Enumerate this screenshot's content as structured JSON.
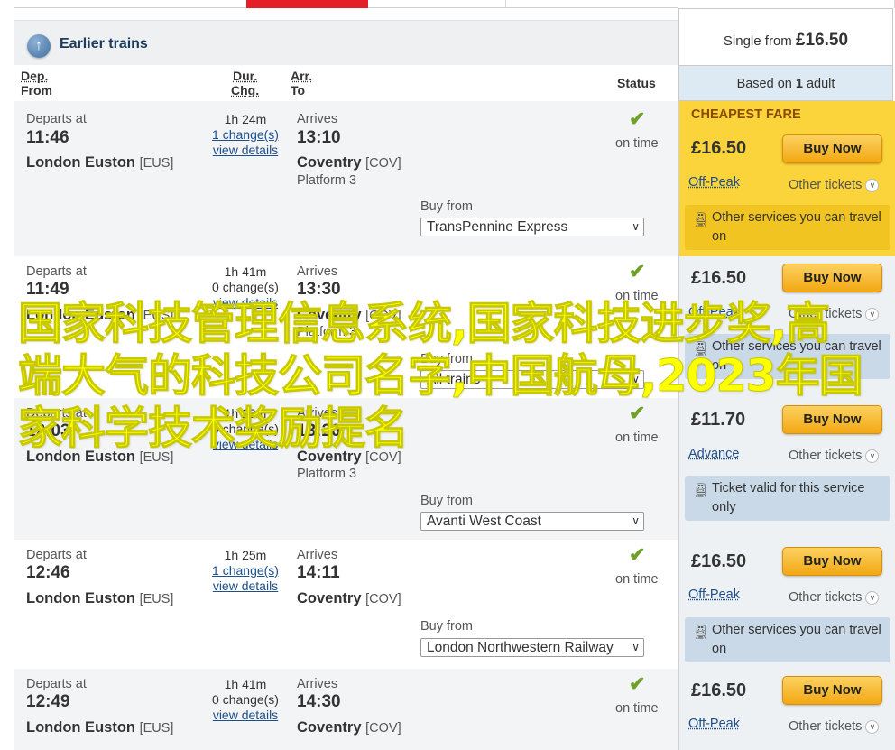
{
  "earlier": {
    "label": "Earlier trains"
  },
  "columns": {
    "dep": "Dep.",
    "from": "From",
    "dur": "Dur.",
    "chg": "Chg.",
    "arr": "Arr.",
    "to": "To",
    "status": "Status"
  },
  "fare_header": {
    "prefix": "Single from ",
    "price": "£16.50",
    "based_prefix": "Based on ",
    "adults": "1",
    "based_suffix": " adult"
  },
  "rows": [
    {
      "departs_label": "Departs at",
      "dep_time": "11:46",
      "from_station": "London Euston",
      "from_code": "[EUS]",
      "duration": "1h 24m",
      "changes": "1 change(s)",
      "details": "view details",
      "arrives_label": "Arrives",
      "arr_time": "13:10",
      "to_station": "Coventry",
      "to_code": "[COV]",
      "platform": "Platform 3",
      "status_icon": "check-icon",
      "status": "on time",
      "buy_from_label": "Buy from",
      "operator": "TransPennine Express",
      "fare_tag": "CHEAPEST FARE",
      "price": "£16.50",
      "buy_label": "Buy Now",
      "ticket_type": "Off-Peak",
      "other_tickets": "Other tickets",
      "note": "Other services you can travel on"
    },
    {
      "departs_label": "Departs at",
      "dep_time": "11:49",
      "from_station": "London Euston",
      "from_code": "[EUS]",
      "duration": "1h 41m",
      "changes": "0 change(s)",
      "details": "view details",
      "arrives_label": "Arrives",
      "arr_time": "13:30",
      "to_station": "Coventry",
      "to_code": "[COV]",
      "platform": "Platform 3",
      "status_icon": "check-icon",
      "status": "on time",
      "buy_from_label": "Buy from",
      "operator": "All trains",
      "price": "£16.50",
      "buy_label": "Buy Now",
      "ticket_type": "Off-Peak",
      "other_tickets": "Other tickets",
      "note": "Other services you can travel on"
    },
    {
      "departs_label": "Departs at",
      "dep_time": "12:03",
      "from_station": "London Euston",
      "from_code": "[EUS]",
      "duration": "1h 23m",
      "changes": "0 change(s)",
      "details": "view details",
      "arrives_label": "Arrives",
      "arr_time": "13:26",
      "to_station": "Coventry",
      "to_code": "[COV]",
      "platform": "Platform 3",
      "status_icon": "check-icon",
      "status": "on time",
      "buy_from_label": "Buy from",
      "operator": "Avanti West Coast",
      "price": "£11.70",
      "buy_label": "Buy Now",
      "ticket_type": "Advance",
      "other_tickets": "Other tickets",
      "note": "Ticket valid for this service only"
    },
    {
      "departs_label": "Departs at",
      "dep_time": "12:46",
      "from_station": "London Euston",
      "from_code": "[EUS]",
      "duration": "1h 25m",
      "changes": "1 change(s)",
      "details": "view details",
      "arrives_label": "Arrives",
      "arr_time": "14:11",
      "to_station": "Coventry",
      "to_code": "[COV]",
      "platform": "",
      "status_icon": "check-icon",
      "status": "on time",
      "buy_from_label": "Buy from",
      "operator": "London Northwestern Railway",
      "price": "£16.50",
      "buy_label": "Buy Now",
      "ticket_type": "Off-Peak",
      "other_tickets": "Other tickets",
      "note": "Other services you can travel on"
    },
    {
      "departs_label": "Departs at",
      "dep_time": "12:49",
      "from_station": "London Euston",
      "from_code": "[EUS]",
      "duration": "1h 41m",
      "changes": "0 change(s)",
      "details": "view details",
      "arrives_label": "Arrives",
      "arr_time": "14:30",
      "to_station": "Coventry",
      "to_code": "[COV]",
      "platform": "",
      "status_icon": "check-icon",
      "status": "on time",
      "price": "£16.50",
      "buy_label": "Buy Now",
      "ticket_type": "Off-Peak",
      "other_tickets": "Other tickets"
    }
  ],
  "overlay_text": "国家科技管理信息系统,国家科技进步奖,高端大气的科技公司名字,中国航母,2023年国家科学技术奖励提名",
  "colors": {
    "accent_red": "#e41f26",
    "cheapest_yellow": "#fbd33a",
    "buy_orange": "#f2a813",
    "check_green": "#6fa02a",
    "overlay_yellow": "#fcff00"
  }
}
